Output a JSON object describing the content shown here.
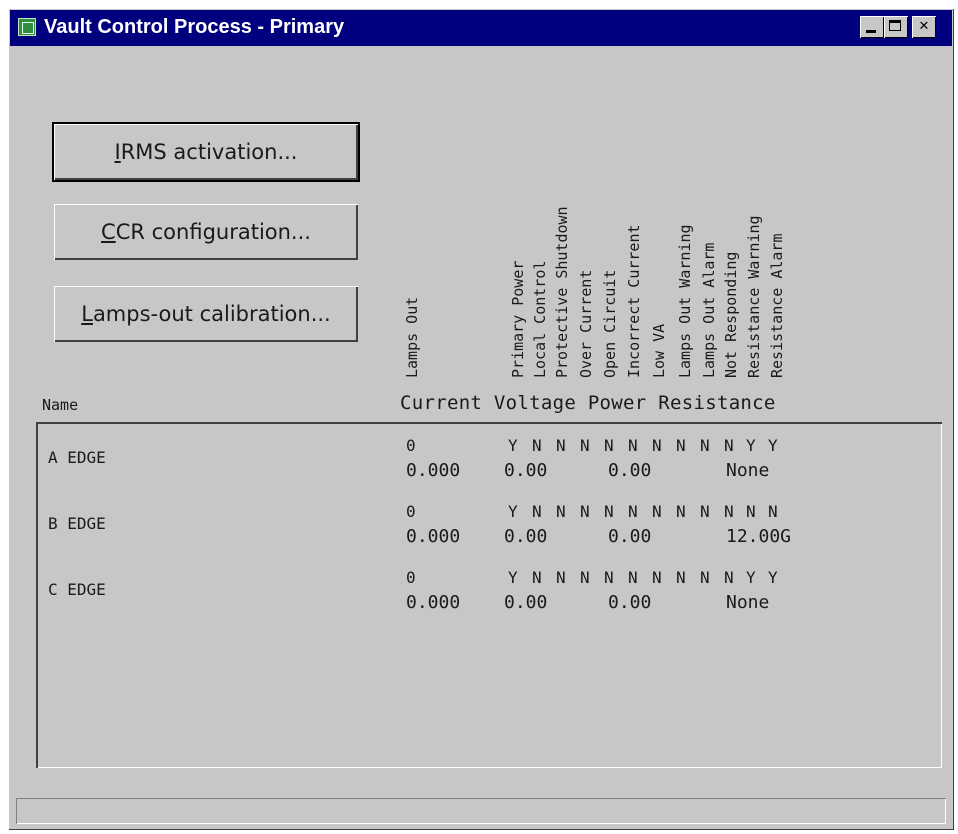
{
  "window": {
    "title": "Vault Control Process - Primary"
  },
  "buttons": {
    "irms": {
      "mnemonic": "I",
      "rest": "RMS activation..."
    },
    "ccr": {
      "mnemonic": "C",
      "rest": "CR configuration..."
    },
    "lamps": {
      "mnemonic": "L",
      "rest": "amps-out calibration..."
    }
  },
  "column_headers": [
    "Lamps Out",
    "Primary Power",
    "Local Control",
    "Protective Shutdown",
    "Over Current",
    "Open Circuit",
    "Incorrect Current",
    "Low VA",
    "Lamps Out Warning",
    "Lamps Out Alarm",
    "Not Responding",
    "Resistance Warning",
    "Resistance Alarm"
  ],
  "list_header": {
    "name": "Name",
    "measures": "Current Voltage Power Resistance"
  },
  "rows": [
    {
      "name": "A EDGE",
      "lamps_out": "0",
      "flags": [
        "Y",
        "N",
        "N",
        "N",
        "N",
        "N",
        "N",
        "N",
        "N",
        "N",
        "Y",
        "Y"
      ],
      "current": "0.000",
      "voltage": "0.00",
      "power": "0.00",
      "resistance": "None"
    },
    {
      "name": "B EDGE",
      "lamps_out": "0",
      "flags": [
        "Y",
        "N",
        "N",
        "N",
        "N",
        "N",
        "N",
        "N",
        "N",
        "N",
        "N",
        "N"
      ],
      "current": "0.000",
      "voltage": "0.00",
      "power": "0.00",
      "resistance": "12.00G"
    },
    {
      "name": "C EDGE",
      "lamps_out": "0",
      "flags": [
        "Y",
        "N",
        "N",
        "N",
        "N",
        "N",
        "N",
        "N",
        "N",
        "N",
        "Y",
        "Y"
      ],
      "current": "0.000",
      "voltage": "0.00",
      "power": "0.00",
      "resistance": "None"
    }
  ],
  "status_bar": {
    "text": ""
  }
}
